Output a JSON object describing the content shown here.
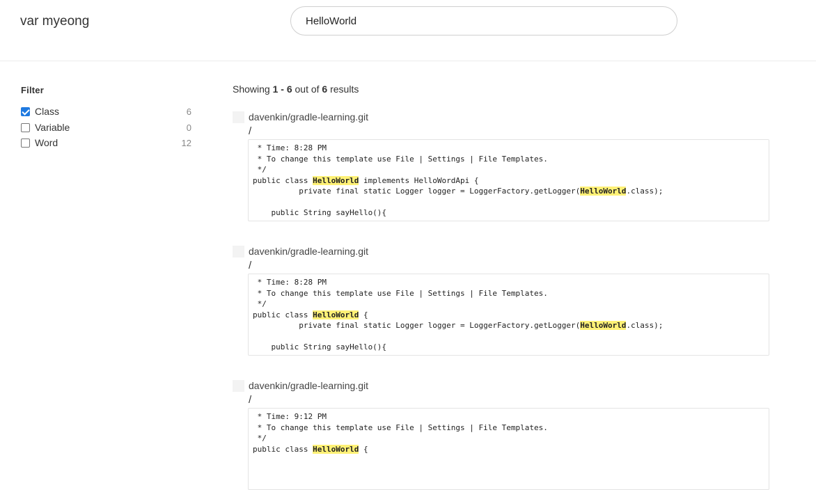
{
  "header": {
    "logo": "var myeong",
    "search_value": "HelloWorld"
  },
  "filter": {
    "title": "Filter",
    "items": [
      {
        "label": "Class",
        "count": "6",
        "checked": true
      },
      {
        "label": "Variable",
        "count": "0",
        "checked": false
      },
      {
        "label": "Word",
        "count": "12",
        "checked": false
      }
    ]
  },
  "summary": {
    "prefix": "Showing ",
    "range": "1 - 6",
    "middle": " out of ",
    "total": "6",
    "suffix": " results"
  },
  "results": [
    {
      "repo": "davenkin/gradle-learning.git",
      "path": "/",
      "lines": [
        [
          {
            "t": " * Time: 8:28 PM"
          }
        ],
        [
          {
            "t": " * To change this template use File | Settings | File Templates."
          }
        ],
        [
          {
            "t": " */"
          }
        ],
        [
          {
            "t": "public class "
          },
          {
            "t": "HelloWorld",
            "hl": true
          },
          {
            "t": " implements HelloWordApi {"
          }
        ],
        [
          {
            "t": "          private final static Logger logger = LoggerFactory.getLogger("
          },
          {
            "t": "HelloWorld",
            "hl": true
          },
          {
            "t": ".class);"
          }
        ],
        [
          {
            "t": ""
          }
        ],
        [
          {
            "t": "    public String sayHello(){"
          }
        ]
      ]
    },
    {
      "repo": "davenkin/gradle-learning.git",
      "path": "/",
      "lines": [
        [
          {
            "t": " * Time: 8:28 PM"
          }
        ],
        [
          {
            "t": " * To change this template use File | Settings | File Templates."
          }
        ],
        [
          {
            "t": " */"
          }
        ],
        [
          {
            "t": "public class "
          },
          {
            "t": "HelloWorld",
            "hl": true
          },
          {
            "t": " {"
          }
        ],
        [
          {
            "t": "          private final static Logger logger = LoggerFactory.getLogger("
          },
          {
            "t": "HelloWorld",
            "hl": true
          },
          {
            "t": ".class);"
          }
        ],
        [
          {
            "t": ""
          }
        ],
        [
          {
            "t": "    public String sayHello(){"
          }
        ]
      ]
    },
    {
      "repo": "davenkin/gradle-learning.git",
      "path": "/",
      "lines": [
        [
          {
            "t": " * Time: 9:12 PM"
          }
        ],
        [
          {
            "t": " * To change this template use File | Settings | File Templates."
          }
        ],
        [
          {
            "t": " */"
          }
        ],
        [
          {
            "t": "public class "
          },
          {
            "t": "HelloWorld",
            "hl": true
          },
          {
            "t": " {"
          }
        ]
      ]
    }
  ]
}
